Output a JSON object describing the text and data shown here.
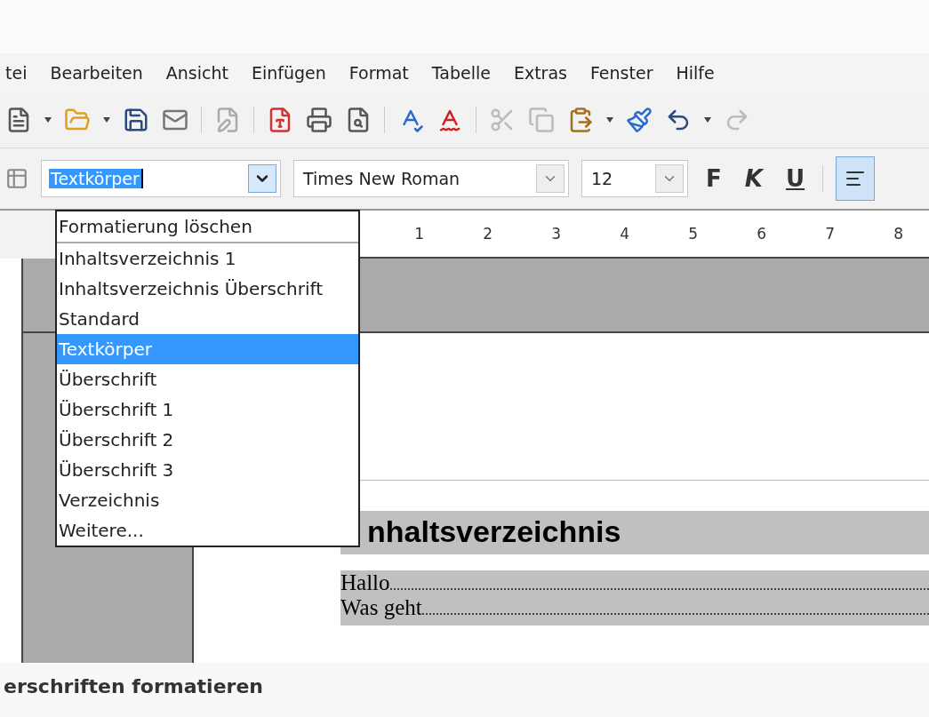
{
  "menu_bar": [
    {
      "label": "tei"
    },
    {
      "label": "Bearbeiten"
    },
    {
      "label": "Ansicht"
    },
    {
      "label": "Einfügen"
    },
    {
      "label": "Format"
    },
    {
      "label": "Tabelle"
    },
    {
      "label": "Extras"
    },
    {
      "label": "Fenster"
    },
    {
      "label": "Hilfe"
    }
  ],
  "format_bar": {
    "paragraph_style": "Textkörper",
    "font_name": "Times New Roman",
    "font_size": "12",
    "bold": "F",
    "italic": "K",
    "underline": "U",
    "align_left_active": true
  },
  "style_dropdown": {
    "items": [
      {
        "label": "Formatierung löschen",
        "selected": false
      },
      {
        "label": "Inhaltsverzeichnis 1",
        "selected": false
      },
      {
        "label": "Inhaltsverzeichnis Überschrift",
        "selected": false
      },
      {
        "label": "Standard",
        "selected": false
      },
      {
        "label": "Textkörper",
        "selected": true
      },
      {
        "label": "Überschrift",
        "selected": false
      },
      {
        "label": "Überschrift 1",
        "selected": false
      },
      {
        "label": "Überschrift 2",
        "selected": false
      },
      {
        "label": "Überschrift 3",
        "selected": false
      },
      {
        "label": "Verzeichnis",
        "selected": false
      },
      {
        "label": "Weitere...",
        "selected": false
      }
    ]
  },
  "ruler": [
    "1",
    "2",
    "3",
    "4",
    "5",
    "6",
    "7",
    "8"
  ],
  "document": {
    "heading": "nhaltsverzeichnis",
    "toc_entries": [
      {
        "text": "Hallo"
      },
      {
        "text": "Was geht"
      }
    ]
  },
  "caption": "erschriften formatieren"
}
